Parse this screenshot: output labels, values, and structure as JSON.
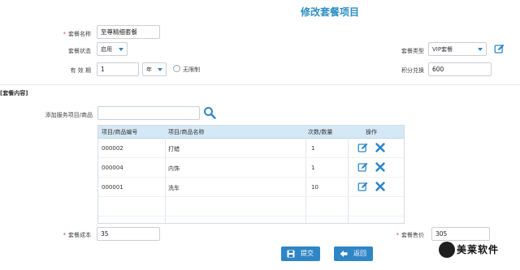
{
  "page_title": "修改套餐项目",
  "form": {
    "name_label": "套餐名称",
    "name_value": "至尊精细套餐",
    "status_label": "套餐状态",
    "status_value": "启用",
    "validity_label": "有 效 期",
    "validity_value": "1",
    "validity_unit": "年",
    "unlimited_label": "无限制",
    "type_label": "套餐类型",
    "type_value": "VIP套餐",
    "points_label": "积分兑换",
    "points_value": "600"
  },
  "section": {
    "title": "[套餐内容]"
  },
  "add_item": {
    "label": "添加服务项目/商品",
    "value": ""
  },
  "table": {
    "headers": [
      "项目/商品编号",
      "项目/商品名称",
      "次数/数量",
      "操作"
    ],
    "rows": [
      {
        "code": "000002",
        "name": "打蜡",
        "qty": "1"
      },
      {
        "code": "000004",
        "name": "内饰",
        "qty": "1"
      },
      {
        "code": "000001",
        "name": "洗车",
        "qty": "10"
      }
    ]
  },
  "cost": {
    "label": "套餐成本",
    "value": "35"
  },
  "price": {
    "label": "套餐售价",
    "value": "305"
  },
  "buttons": {
    "submit": "提交",
    "back": "返回"
  },
  "watermark": {
    "text": "美莱软件"
  },
  "colors": {
    "accent": "#2f86c7",
    "title": "#2f8fc4",
    "required": "#e04a3a",
    "header_bg": "#d4e8f5"
  },
  "icons": {
    "search": "search-icon",
    "edit": "edit-icon",
    "delete": "delete-icon",
    "save": "save-icon",
    "back": "back-arrow-icon"
  }
}
